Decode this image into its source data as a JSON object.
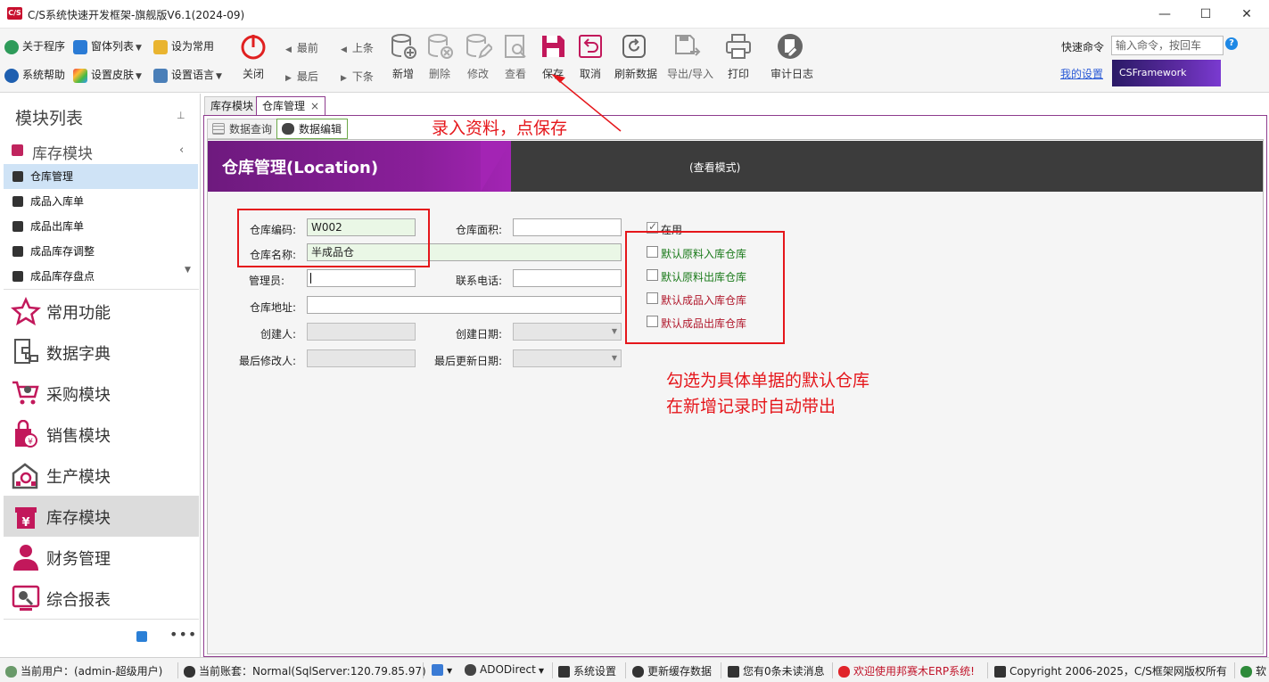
{
  "window": {
    "logo_text": "C/S",
    "title": "C/S系统快速开发框架-旗舰版V6.1(2024-09)",
    "minimize": "—",
    "maximize": "☐",
    "close": "✕"
  },
  "ribbon": {
    "quick_items": {
      "about": "关于程序",
      "window_list": "窗体列表",
      "set_common": "设为常用",
      "system_help": "系统帮助",
      "skin": "设置皮肤",
      "language": "设置语言"
    },
    "close_label": "关闭",
    "nav": {
      "first": "最前",
      "prev": "上条",
      "last": "最后",
      "next": "下条"
    },
    "buttons": {
      "add": "新增",
      "delete": "删除",
      "edit": "修改",
      "view": "查看",
      "save": "保存",
      "cancel": "取消",
      "refresh": "刷新数据",
      "export": "导出/导入",
      "print": "打印",
      "audit": "审计日志"
    },
    "command_label": "快速命令",
    "command_placeholder": "输入命令，按回车",
    "my_settings": "我的设置",
    "brand": "CSFramework",
    "help_icon": "?"
  },
  "sidebar": {
    "title": "模块列表",
    "pin": "⊥",
    "group": "库存模块",
    "items": [
      "仓库管理",
      "成品入库单",
      "成品出库单",
      "成品库存调整",
      "成品库存盘点"
    ],
    "modules": [
      "常用功能",
      "数据字典",
      "采购模块",
      "销售模块",
      "生产模块",
      "库存模块",
      "财务管理",
      "综合报表"
    ],
    "more": "•••"
  },
  "tabs": {
    "doc_tabs": [
      "库存模块",
      "仓库管理"
    ],
    "close_x": "×",
    "sub_tabs": [
      "数据查询",
      "数据编辑"
    ]
  },
  "header": {
    "title": "仓库管理(Location)",
    "mode": "(查看模式)"
  },
  "form": {
    "code_label": "仓库编码:",
    "code_value": "W002",
    "name_label": "仓库名称:",
    "name_value": "半成品仓",
    "manager_label": "管理员:",
    "manager_value": "",
    "address_label": "仓库地址:",
    "address_value": "",
    "creator_label": "创建人:",
    "creator_value": "",
    "modifier_label": "最后修改人:",
    "modifier_value": "",
    "area_label": "仓库面积:",
    "area_value": "",
    "phone_label": "联系电话:",
    "phone_value": "",
    "create_date_label": "创建日期:",
    "update_date_label": "最后更新日期:",
    "in_use_label": "在用",
    "in_use_checked": true,
    "checkboxes": [
      "默认原料入库仓库",
      "默认原料出库仓库",
      "默认成品入库仓库",
      "默认成品出库仓库"
    ]
  },
  "annotations": {
    "save_hint": "录入资料，点保存",
    "hint_line1": "勾选为具体单据的默认仓库",
    "hint_line2": "在新增记录时自动带出"
  },
  "statusbar": {
    "user": "当前用户：(admin-超级用户)",
    "account": "当前账套：Normal(SqlServer:120.79.85.97)",
    "conn": "ADODirect",
    "settings": "系统设置",
    "cache": "更新缓存数据",
    "messages": "您有0条未读消息",
    "welcome": "欢迎使用邦赛木ERP系统!",
    "copyright": "Copyright 2006-2025，C/S框架网版权所有",
    "extra": "软"
  },
  "colors": {
    "accent_purple": "#8a1f9a",
    "annotation_red": "#e5161b",
    "sidebar_active": "#cfe3f6",
    "checkbox_green": "#1a7a1a",
    "checkbox_red": "#b0162a"
  }
}
